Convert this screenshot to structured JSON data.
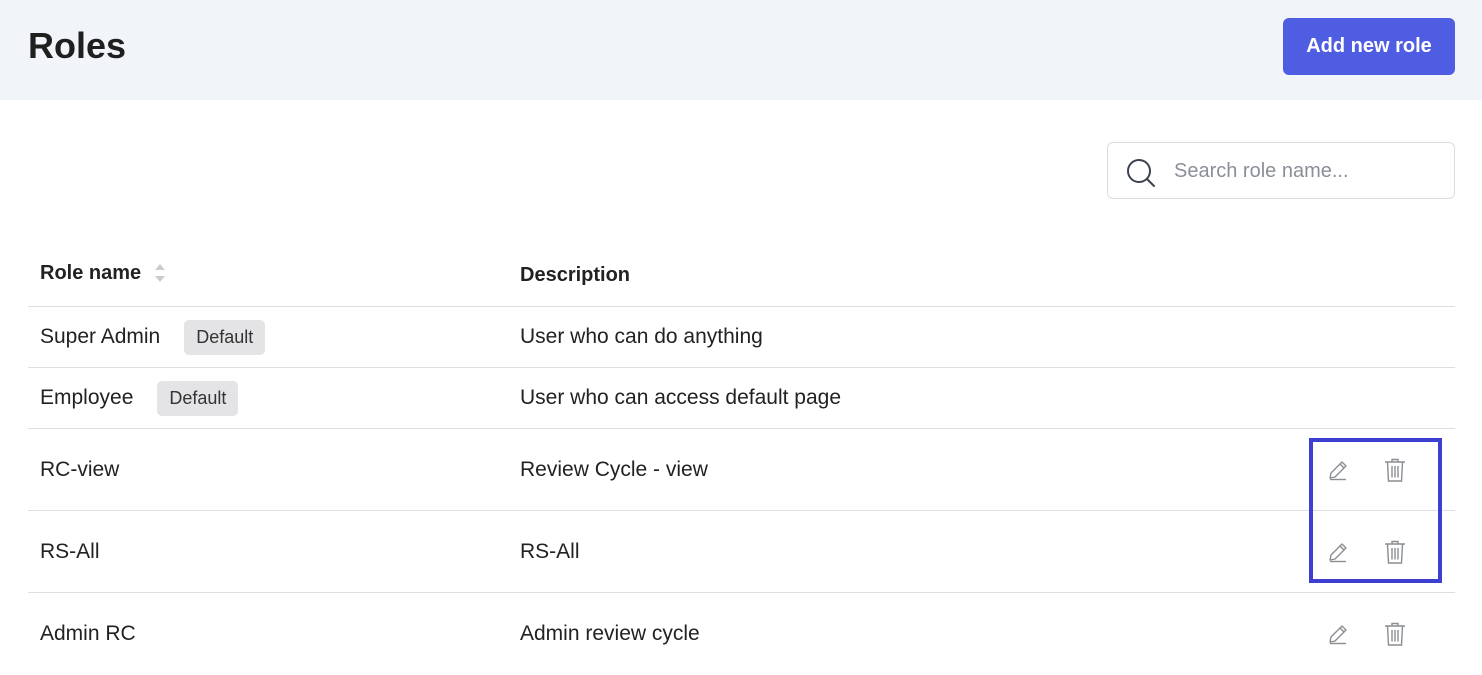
{
  "header": {
    "title": "Roles",
    "add_button_label": "Add new role",
    "background_color": "#f1f4f9",
    "accent_color": "#4f5de3"
  },
  "search": {
    "placeholder": "Search role name...",
    "value": "",
    "icon": "search-icon"
  },
  "table": {
    "columns": {
      "name": "Role name",
      "description": "Description"
    },
    "sort_icon": "sort-icon",
    "rows": [
      {
        "name": "Super Admin",
        "badge": "Default",
        "description": "User who can do anything",
        "actions": false
      },
      {
        "name": "Employee",
        "badge": "Default",
        "description": "User who can access default page",
        "actions": false
      },
      {
        "name": "RC-view",
        "badge": "",
        "description": "Review Cycle - view",
        "actions": true
      },
      {
        "name": "RS-All",
        "badge": "",
        "description": "RS-All",
        "actions": true
      },
      {
        "name": "Admin RC",
        "badge": "",
        "description": "Admin review cycle",
        "actions": true
      }
    ],
    "action_icons": [
      "edit-icon",
      "delete-icon"
    ],
    "highlight_color": "#3d3fd1"
  }
}
